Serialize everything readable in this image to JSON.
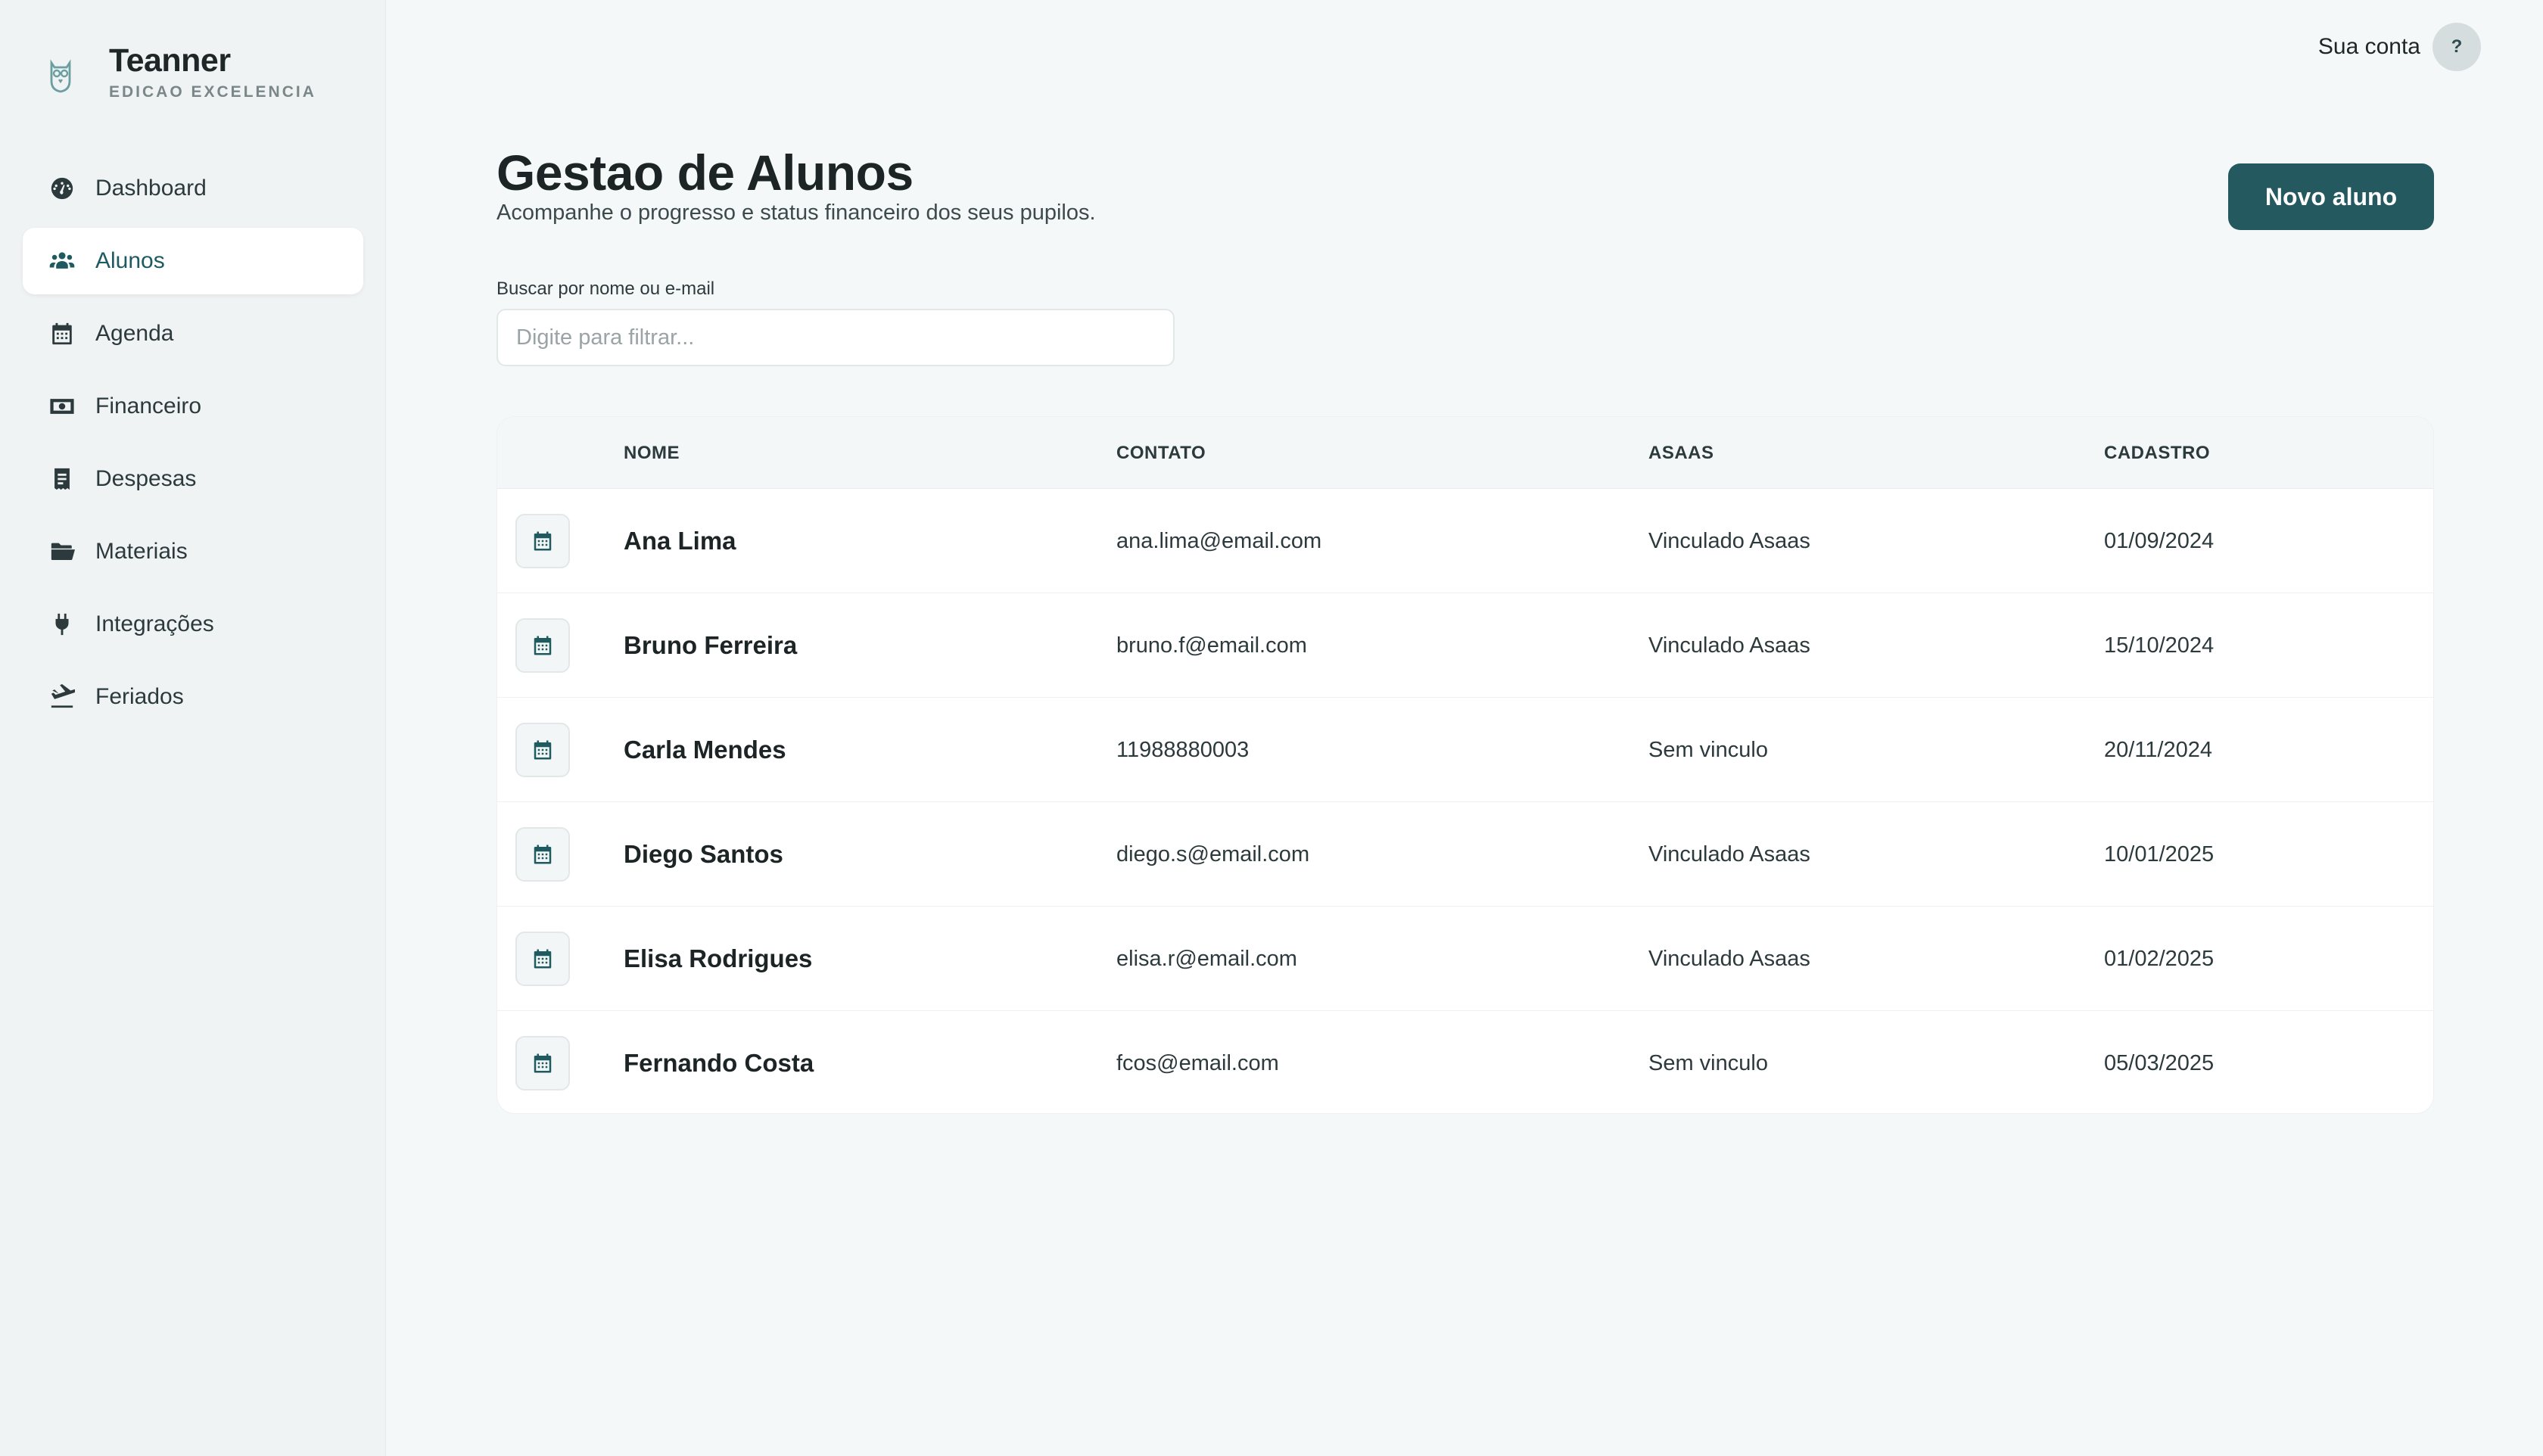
{
  "brand": {
    "name": "Teanner",
    "subtitle": "EDICAO EXCELENCIA"
  },
  "sidebar": {
    "items": [
      {
        "label": "Dashboard",
        "icon": "gauge-icon",
        "active": false
      },
      {
        "label": "Alunos",
        "icon": "users-icon",
        "active": true
      },
      {
        "label": "Agenda",
        "icon": "calendar-icon",
        "active": false
      },
      {
        "label": "Financeiro",
        "icon": "money-icon",
        "active": false
      },
      {
        "label": "Despesas",
        "icon": "receipt-icon",
        "active": false
      },
      {
        "label": "Materiais",
        "icon": "folder-icon",
        "active": false
      },
      {
        "label": "Integrações",
        "icon": "plug-icon",
        "active": false
      },
      {
        "label": "Feriados",
        "icon": "plane-icon",
        "active": false
      }
    ]
  },
  "account": {
    "label": "Sua conta",
    "avatar": "?"
  },
  "header": {
    "title": "Gestao de Alunos",
    "subtitle": "Acompanhe o progresso e status financeiro dos seus pupilos.",
    "new_button": "Novo aluno"
  },
  "search": {
    "label": "Buscar por nome ou e-mail",
    "placeholder": "Digite para filtrar...",
    "value": ""
  },
  "table": {
    "columns": [
      "NOME",
      "CONTATO",
      "ASAAS",
      "CADASTRO"
    ],
    "rows": [
      {
        "name": "Ana Lima",
        "contact": "ana.lima@email.com",
        "asaas": "Vinculado Asaas",
        "date": "01/09/2024"
      },
      {
        "name": "Bruno Ferreira",
        "contact": "bruno.f@email.com",
        "asaas": "Vinculado Asaas",
        "date": "15/10/2024"
      },
      {
        "name": "Carla Mendes",
        "contact": "11988880003",
        "asaas": "Sem vinculo",
        "date": "20/11/2024"
      },
      {
        "name": "Diego Santos",
        "contact": "diego.s@email.com",
        "asaas": "Vinculado Asaas",
        "date": "10/01/2025"
      },
      {
        "name": "Elisa Rodrigues",
        "contact": "elisa.r@email.com",
        "asaas": "Vinculado Asaas",
        "date": "01/02/2025"
      },
      {
        "name": "Fernando Costa",
        "contact": "fcos@email.com",
        "asaas": "Sem vinculo",
        "date": "05/03/2025"
      }
    ]
  },
  "colors": {
    "accent": "#24595f",
    "background": "#f5f8f8",
    "sidebar": "#f0f3f3"
  }
}
